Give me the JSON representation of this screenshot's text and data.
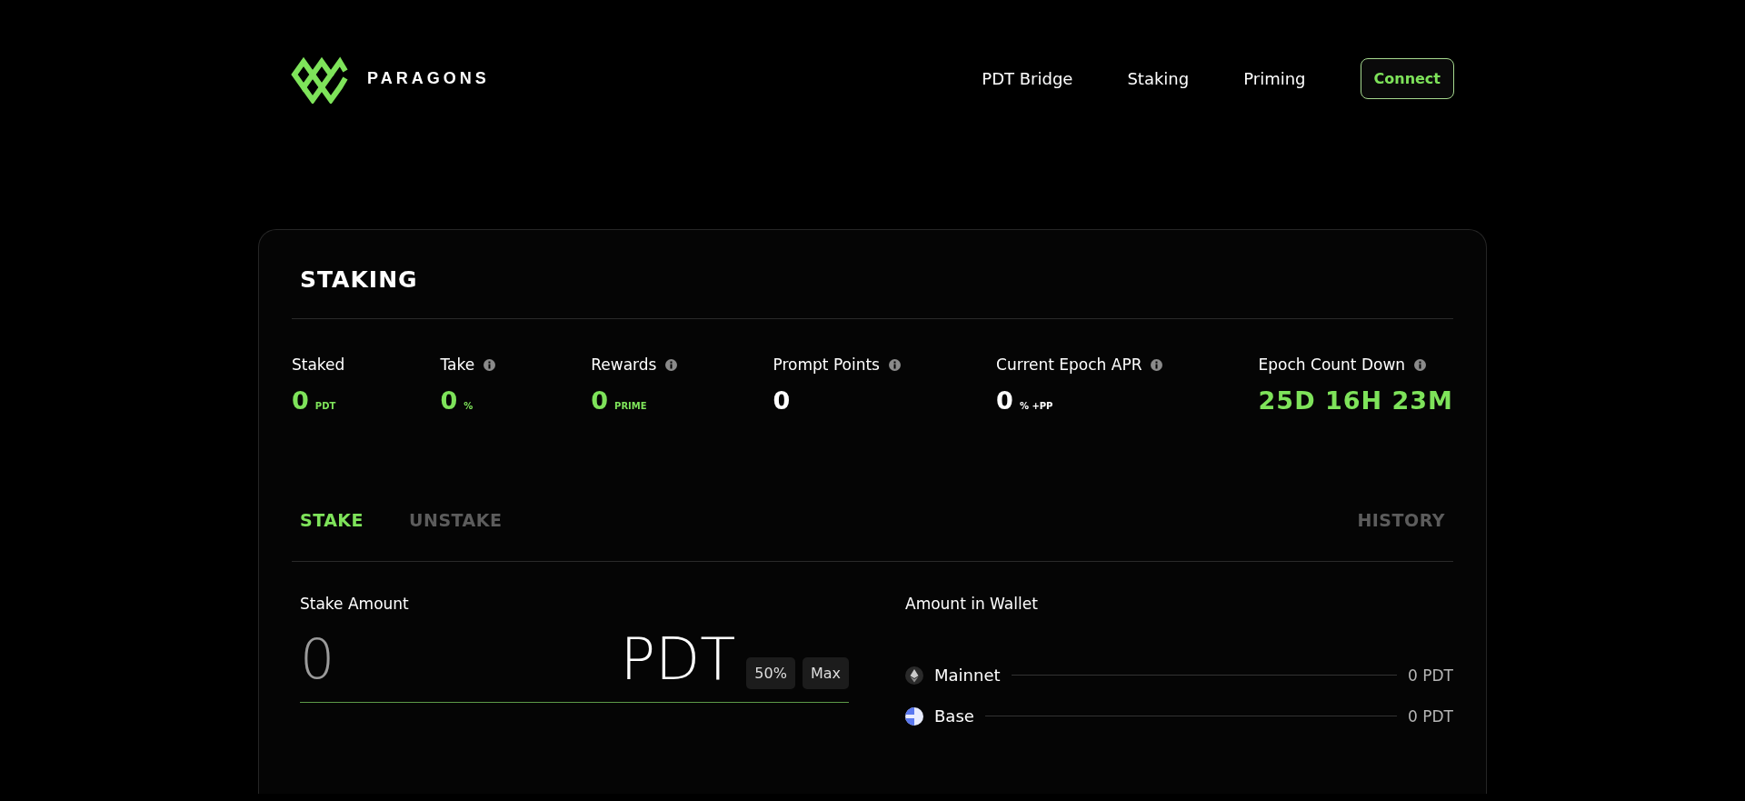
{
  "header": {
    "brand": "PARAGONS",
    "nav": [
      {
        "label": "PDT Bridge",
        "selected": false
      },
      {
        "label": "Staking",
        "selected": false
      },
      {
        "label": "Priming",
        "selected": false
      }
    ],
    "connect_button": "Connect"
  },
  "card": {
    "title": "STAKING",
    "stats": [
      {
        "label": "Staked",
        "info": false,
        "value": "0",
        "unit": "PDT",
        "highlight": true
      },
      {
        "label": "Take",
        "info": true,
        "value": "0",
        "unit": "%",
        "highlight": true
      },
      {
        "label": "Rewards",
        "info": true,
        "value": "0",
        "unit": "PRIME",
        "highlight": true
      },
      {
        "label": "Prompt Points",
        "info": true,
        "value": "0",
        "highlight": false
      },
      {
        "label": "Current Epoch APR",
        "info": true,
        "value": "0",
        "unit": "% +PP",
        "highlight": false
      },
      {
        "label": "Epoch Count Down",
        "info": true,
        "value": "25D 16H 23M",
        "highlight": true
      }
    ],
    "tabs": [
      {
        "label": "STAKE",
        "selected": true
      },
      {
        "label": "UNSTAKE",
        "selected": false
      }
    ],
    "history": "HISTORY",
    "stake": {
      "label": "Stake Amount",
      "placeholder": "0",
      "unit": "PDT",
      "buttons": [
        "50%",
        "Max"
      ]
    },
    "wallet": {
      "label": "Amount in Wallet",
      "networks": [
        {
          "kind": "eth",
          "name": "Mainnet",
          "amount": "0 PDT"
        },
        {
          "kind": "base",
          "name": "Base",
          "amount": "0 PDT"
        }
      ]
    }
  }
}
